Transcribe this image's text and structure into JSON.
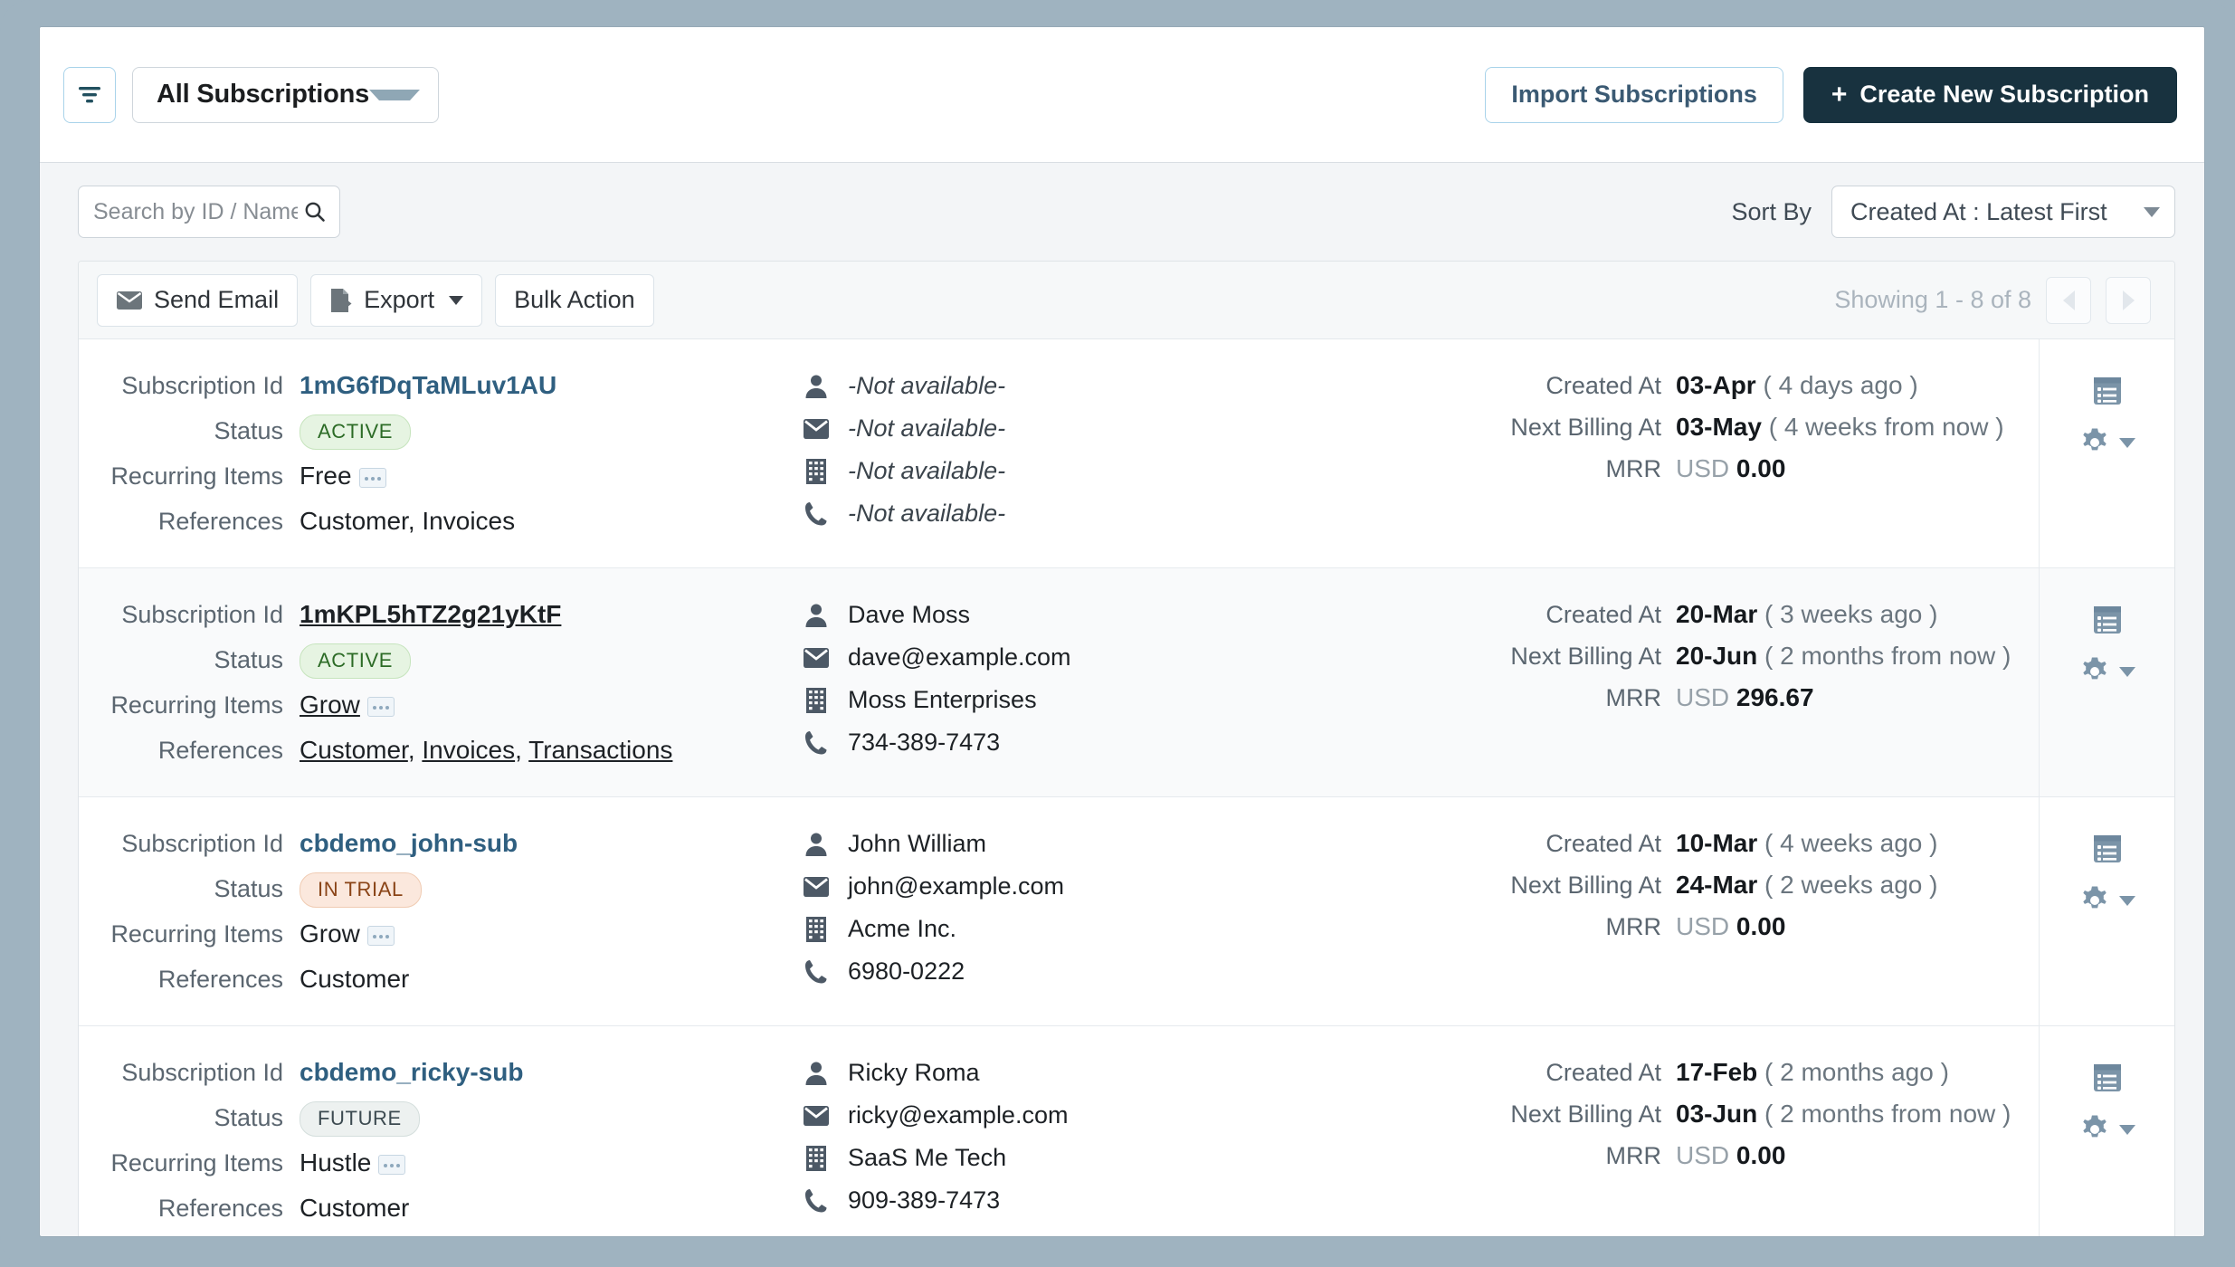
{
  "topbar": {
    "filter_icon": "filter-icon",
    "scope_label": "All Subscriptions",
    "import_label": "Import Subscriptions",
    "create_plus": "+",
    "create_label": "Create New Subscription"
  },
  "search": {
    "placeholder": "Search by ID / Name / Company",
    "value": "",
    "icon": "search-icon"
  },
  "sort": {
    "label": "Sort By",
    "value": "Created At : Latest First"
  },
  "bulkbar": {
    "send_email_label": "Send Email",
    "export_label": "Export",
    "bulk_action_label": "Bulk Action",
    "showing_text": "Showing 1 - 8 of 8"
  },
  "labels": {
    "subscription_id": "Subscription Id",
    "status": "Status",
    "recurring_items": "Recurring Items",
    "references": "References",
    "created_at": "Created At",
    "next_billing_at": "Next Billing At",
    "mrr": "MRR"
  },
  "colors": {
    "accent_dark": "#18323f",
    "link_blue": "#2f5f80",
    "badge_active": "#2c6b26",
    "badge_trial": "#8a4417",
    "badge_future": "#3c4a50",
    "page_bg": "#9fb3c0",
    "icon_slate": "#7b94a8"
  },
  "rows": [
    {
      "sub_id": "1mG6fDqTaMLuv1AU",
      "status": "ACTIVE",
      "status_kind": "active",
      "recurring_items": "Free",
      "references": [
        "Customer",
        "Invoices"
      ],
      "hovered": false,
      "contact": {
        "name": "-Not available-",
        "email": "-Not available-",
        "company": "-Not available-",
        "phone": "-Not available-",
        "unavailable": true
      },
      "created_at_date": "03-Apr",
      "created_at_rel": "( 4 days ago )",
      "next_billing_date": "03-May",
      "next_billing_rel": "( 4 weeks from now )",
      "mrr_currency": "USD",
      "mrr_amount": "0.00"
    },
    {
      "sub_id": "1mKPL5hTZ2g21yKtF",
      "status": "ACTIVE",
      "status_kind": "active",
      "recurring_items": "Grow",
      "references": [
        "Customer",
        "Invoices",
        "Transactions"
      ],
      "hovered": true,
      "contact": {
        "name": "Dave Moss",
        "email": "dave@example.com",
        "company": "Moss Enterprises",
        "phone": "734-389-7473",
        "unavailable": false
      },
      "created_at_date": "20-Mar",
      "created_at_rel": "( 3 weeks ago )",
      "next_billing_date": "20-Jun",
      "next_billing_rel": "( 2 months from now )",
      "mrr_currency": "USD",
      "mrr_amount": "296.67"
    },
    {
      "sub_id": "cbdemo_john-sub",
      "status": "IN TRIAL",
      "status_kind": "trial",
      "recurring_items": "Grow",
      "references": [
        "Customer"
      ],
      "hovered": false,
      "contact": {
        "name": "John William",
        "email": "john@example.com",
        "company": "Acme Inc.",
        "phone": "6980-0222",
        "unavailable": false
      },
      "created_at_date": "10-Mar",
      "created_at_rel": "( 4 weeks ago )",
      "next_billing_date": "24-Mar",
      "next_billing_rel": "( 2 weeks ago )",
      "mrr_currency": "USD",
      "mrr_amount": "0.00"
    },
    {
      "sub_id": "cbdemo_ricky-sub",
      "status": "FUTURE",
      "status_kind": "future",
      "recurring_items": "Hustle",
      "references": [
        "Customer"
      ],
      "hovered": false,
      "contact": {
        "name": "Ricky Roma",
        "email": "ricky@example.com",
        "company": "SaaS Me Tech",
        "phone": "909-389-7473",
        "unavailable": false
      },
      "created_at_date": "17-Feb",
      "created_at_rel": "( 2 months ago )",
      "next_billing_date": "03-Jun",
      "next_billing_rel": "( 2 months from now )",
      "mrr_currency": "USD",
      "mrr_amount": "0.00"
    }
  ]
}
